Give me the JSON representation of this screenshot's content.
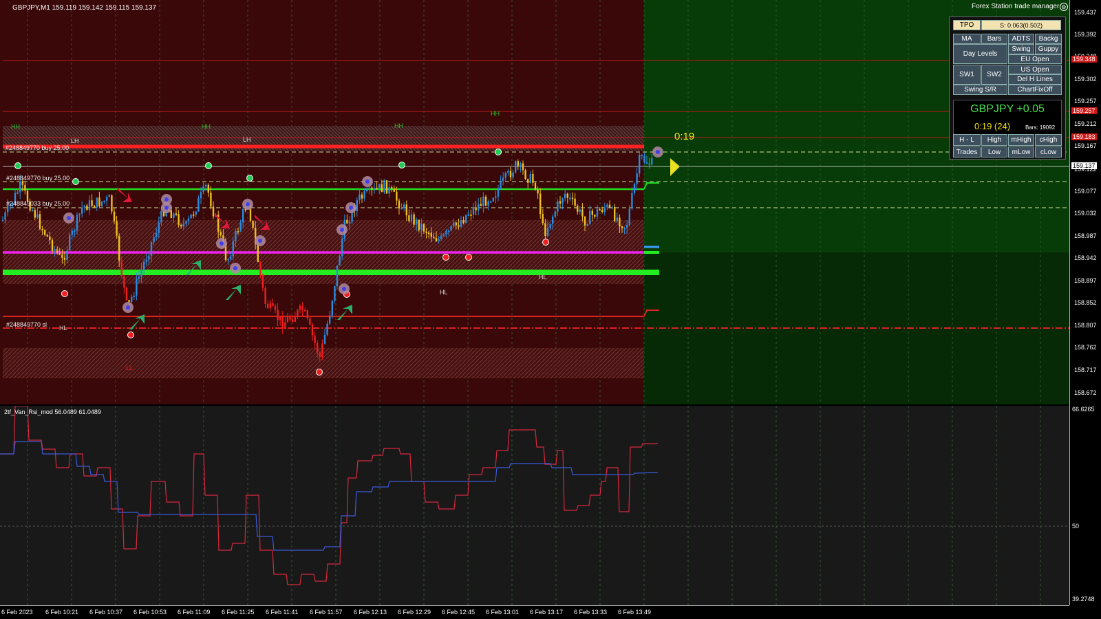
{
  "chart": {
    "title": "GBPJPY,M1  159.119 159.142 159.115 159.137",
    "countdown": "0:19",
    "annotations": {
      "hh": "HH",
      "lh": "LH",
      "hl": "HL",
      "ll": "LL",
      "order_buy_1": "#248849770 buy 25.00",
      "order_buy_2": "#248849033 buy 25.00",
      "order_buy_top": "#248849770 buy 25.00",
      "order_sl": "#248849770 sl"
    },
    "price_axis": [
      "159.437",
      "159.392",
      "159.348",
      "159.302",
      "159.257",
      "159.212",
      "159.183",
      "159.167",
      "159.137",
      "159.122",
      "159.077",
      "159.032",
      "158.987",
      "158.942",
      "158.897",
      "158.852",
      "158.807",
      "158.762",
      "158.717",
      "158.672"
    ],
    "price_tags": {
      "red_1": "159.348",
      "red_2": "159.257",
      "red_3": "159.183",
      "current": "159.137"
    },
    "time_axis": [
      "6 Feb 2023",
      "6 Feb 10:21",
      "6 Feb 10:37",
      "6 Feb 10:53",
      "6 Feb 11:09",
      "6 Feb 11:25",
      "6 Feb 11:41",
      "6 Feb 11:57",
      "6 Feb 12:13",
      "6 Feb 12:29",
      "6 Feb 12:45",
      "6 Feb 13:01",
      "6 Feb 13:17",
      "6 Feb 13:33",
      "6 Feb 13:49"
    ]
  },
  "indicator": {
    "title": "2tf_Van_Rsi_mod 56.0489 61.0489",
    "axis": [
      "66.6265",
      "50",
      "39.2748"
    ]
  },
  "trade_manager": {
    "title": "Forex Station trade manager",
    "tpo": "TPO",
    "spread": "S: 0.063(0.502)",
    "buttons": {
      "ma": "MA",
      "bars": "Bars",
      "adts": "ADTS",
      "backg": "Backg",
      "day_levels": "Day Levels",
      "swing": "Swing",
      "guppy": "Guppy",
      "eu_open": "EU Open",
      "sw1": "SW1",
      "sw2": "SW2",
      "us_open": "US Open",
      "del_h_lines": "Del H Lines",
      "swing_sr": "Swing S/R",
      "chartfixoff": "ChartFixOff",
      "h_l": "H - L",
      "high": "High",
      "mhigh": "mHigh",
      "chigh": "cHigh",
      "trades": "Trades",
      "low": "Low",
      "mlow": "mLow",
      "clow": "cLow"
    },
    "symbol_display": "GBPJPY +0.05",
    "timer": "0:19 (24)",
    "bars": "Bars: 19092"
  },
  "colors": {
    "bg_main": "#3a0808",
    "bg_future": "#063a06",
    "green_line": "#22dd22",
    "magenta_line": "#ee22ee",
    "red_line": "#dd2222",
    "up_candle": "#2a8ce0",
    "down_candle": "#f0c020",
    "crash_candle": "#ee2020",
    "rsi_red": "#d8283e",
    "rsi_blue": "#3a5ad8"
  }
}
